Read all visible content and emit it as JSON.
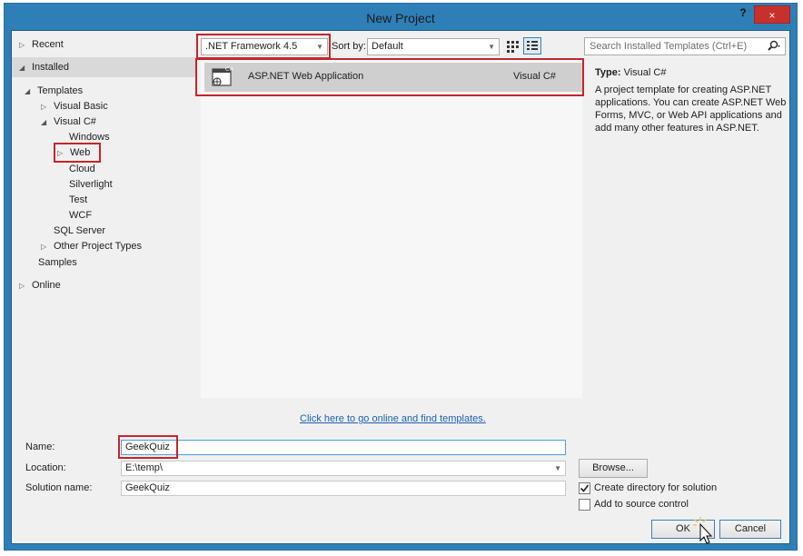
{
  "window": {
    "title": "New Project",
    "help": "?",
    "close": "×"
  },
  "tree": {
    "recent": "Recent",
    "installed": "Installed",
    "templates": "Templates",
    "visual_basic": "Visual Basic",
    "visual_csharp": "Visual C#",
    "windows": "Windows",
    "web": "Web",
    "cloud": "Cloud",
    "silverlight": "Silverlight",
    "test": "Test",
    "wcf": "WCF",
    "sql_server": "SQL Server",
    "other_project_types": "Other Project Types",
    "samples": "Samples",
    "online": "Online"
  },
  "toolbar": {
    "framework": ".NET Framework 4.5",
    "sort_label": "Sort by:",
    "sort_value": "Default"
  },
  "template": {
    "name": "ASP.NET Web Application",
    "language": "Visual C#"
  },
  "online_link": "Click here to go online and find templates.",
  "search": {
    "placeholder": "Search Installed Templates (Ctrl+E)"
  },
  "details": {
    "type_label": "Type:",
    "type_value": "Visual C#",
    "description": "A project template for creating ASP.NET applications. You can create ASP.NET Web Forms, MVC,  or Web API applications and add many other features in ASP.NET."
  },
  "form": {
    "name_label": "Name:",
    "name_value": "GeekQuiz",
    "location_label": "Location:",
    "location_value": "E:\\temp\\",
    "solution_label": "Solution name:",
    "solution_value": "GeekQuiz",
    "browse": "Browse...",
    "create_dir": "Create directory for solution",
    "create_dir_checked": true,
    "source_control": "Add to source control",
    "source_control_checked": false,
    "ok": "OK",
    "cancel": "Cancel"
  },
  "colors": {
    "highlight": "#c3262a",
    "titlebar": "#2f7fb7",
    "link": "#1b5fb0"
  }
}
